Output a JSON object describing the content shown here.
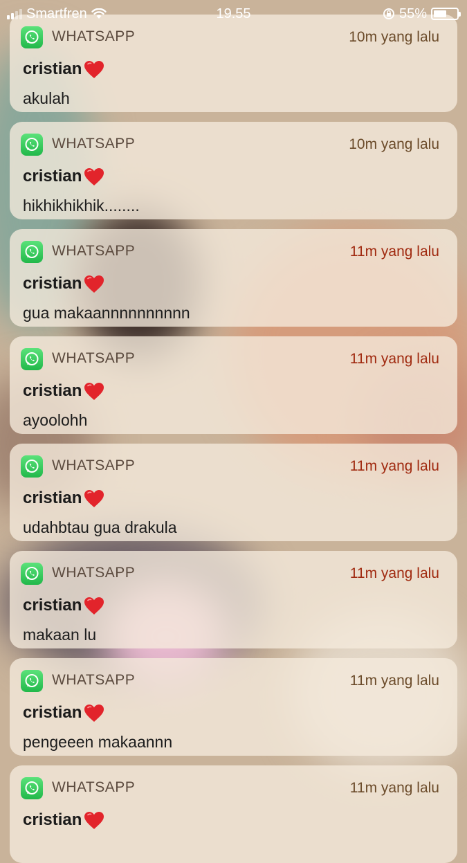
{
  "status_bar": {
    "carrier": "Smartfren",
    "time": "19.55",
    "battery_text": "55%",
    "battery_level": 0.55
  },
  "colors": {
    "whatsapp_green": "#25d366",
    "time_brown": "#6b4b2a",
    "time_red": "#a02a10"
  },
  "notifications": [
    {
      "app": "WHATSAPP",
      "time": "10m yang lalu",
      "sender": "cristian",
      "message": "akulah"
    },
    {
      "app": "WHATSAPP",
      "time": "10m yang lalu",
      "sender": "cristian",
      "message": "hikhikhikhik........"
    },
    {
      "app": "WHATSAPP",
      "time": "11m yang lalu",
      "sender": "cristian",
      "message": "gua makaannnnnnnnnn"
    },
    {
      "app": "WHATSAPP",
      "time": "11m yang lalu",
      "sender": "cristian",
      "message": "ayoolohh"
    },
    {
      "app": "WHATSAPP",
      "time": "11m yang lalu",
      "sender": "cristian",
      "message": "udahbtau gua drakula"
    },
    {
      "app": "WHATSAPP",
      "time": "11m yang lalu",
      "sender": "cristian",
      "message": "makaan lu"
    },
    {
      "app": "WHATSAPP",
      "time": "11m yang lalu",
      "sender": "cristian",
      "message": "pengeeen makaannn"
    },
    {
      "app": "WHATSAPP",
      "time": "11m yang lalu",
      "sender": "cristian",
      "message": ""
    }
  ],
  "icons": {
    "app": "whatsapp-icon",
    "sender_suffix": "red-heart-icon"
  }
}
